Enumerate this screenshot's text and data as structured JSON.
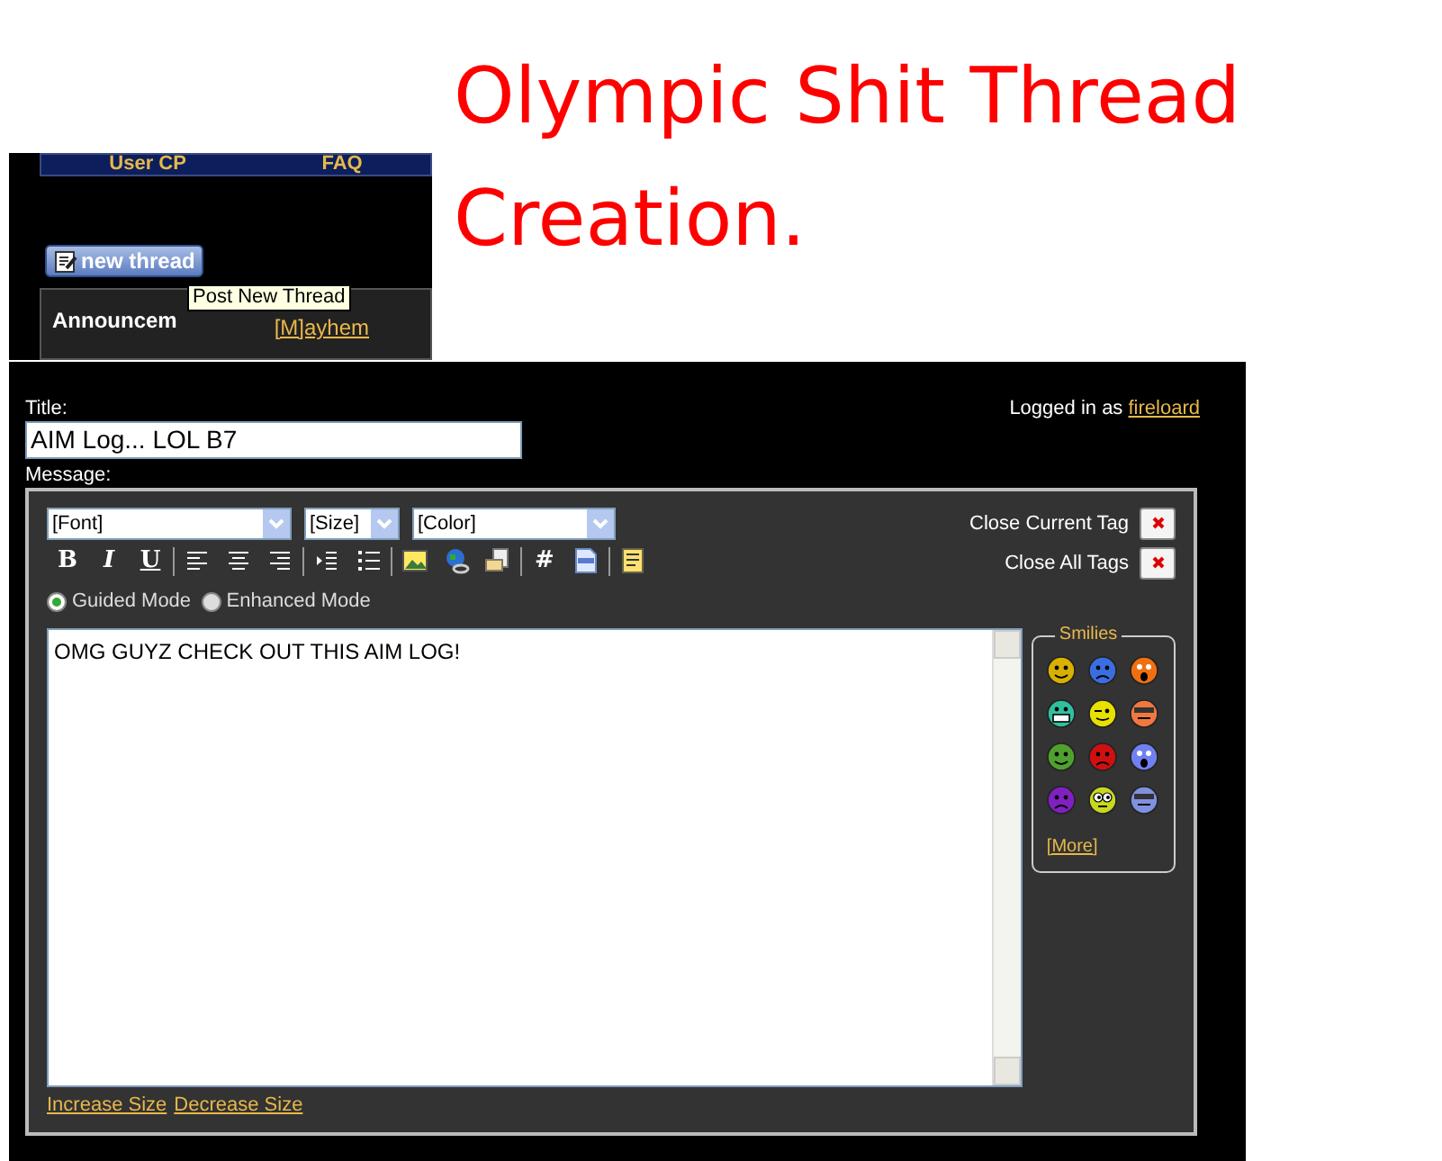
{
  "caption": {
    "lines": [
      "Olympic Shit Thread",
      "Creation."
    ]
  },
  "background_page": {
    "nav_items": [
      "User CP",
      "FAQ"
    ],
    "new_thread_button": "new thread",
    "tooltip": "Post New Thread",
    "announcement_label": "Announcem",
    "announcement_link": "[M]ayhem"
  },
  "editor": {
    "title_label": "Title:",
    "title_value": "AIM Log... LOL B7",
    "logged_in_text": "Logged in as",
    "username": "fireloard",
    "message_label": "Message:",
    "selects": [
      {
        "value": "[Font]"
      },
      {
        "value": "[Size]"
      },
      {
        "value": "[Color]"
      }
    ],
    "toolbar": [
      {
        "kind": "glyph",
        "label": "B"
      },
      {
        "kind": "glyph",
        "label": "I"
      },
      {
        "kind": "glyph",
        "label": "U"
      },
      {
        "kind": "separator"
      },
      {
        "kind": "icon"
      },
      {
        "kind": "icon"
      },
      {
        "kind": "icon"
      },
      {
        "kind": "separator"
      },
      {
        "kind": "icon"
      },
      {
        "kind": "icon"
      },
      {
        "kind": "separator"
      },
      {
        "kind": "icon"
      },
      {
        "kind": "icon"
      },
      {
        "kind": "icon"
      },
      {
        "kind": "separator"
      },
      {
        "kind": "glyph",
        "label": "#"
      },
      {
        "kind": "icon"
      },
      {
        "kind": "separator"
      },
      {
        "kind": "icon"
      }
    ],
    "close_tags": [
      {
        "label": "Close Current Tag"
      },
      {
        "label": "Close All Tags"
      }
    ],
    "modes": [
      {
        "label": "Guided Mode",
        "selected": true
      },
      {
        "label": "Enhanced Mode",
        "selected": false
      }
    ],
    "message_text": "OMG GUYZ CHECK OUT THIS AIM LOG!",
    "smilies": {
      "title": "Smilies",
      "items": [
        {
          "color": "#d8b000"
        },
        {
          "color": "#3a6ee0"
        },
        {
          "color": "#f07010"
        },
        {
          "color": "#30c0a0"
        },
        {
          "color": "#e8e000"
        },
        {
          "color": "#f07840"
        },
        {
          "color": "#50a030"
        },
        {
          "color": "#d01010"
        },
        {
          "color": "#7080f0"
        },
        {
          "color": "#8020c0"
        },
        {
          "color": "#c8d820"
        },
        {
          "color": "#8090e0"
        }
      ],
      "more": "[More]"
    },
    "resize_links": [
      "Increase Size",
      "Decrease Size"
    ]
  }
}
